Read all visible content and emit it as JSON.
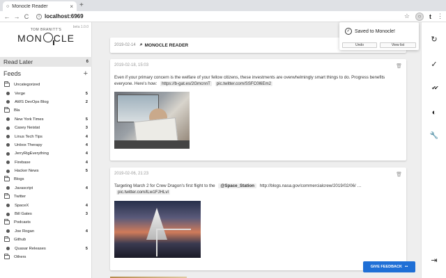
{
  "browser": {
    "tab_title": "Monocle Reader",
    "tab_close": "×",
    "new_tab": "+",
    "back": "←",
    "forward": "→",
    "reload": "C",
    "url": "localhost:6969",
    "star": "☆",
    "ext_t": "t",
    "menu": "⋮"
  },
  "sidebar": {
    "beta": "beta 1.0.0",
    "logo_small": "TOM BRANITT'S",
    "logo_left": "MON",
    "logo_right": "CLE",
    "read_later": {
      "label": "Read Later",
      "count": "6"
    },
    "feeds_label": "Feeds",
    "feeds_add": "+",
    "items": [
      {
        "kind": "folder",
        "label": "Uncategorized",
        "count": ""
      },
      {
        "kind": "feed",
        "label": "Verge",
        "count": "5"
      },
      {
        "kind": "feed",
        "label": "AWS DevOps Blog",
        "count": "2"
      },
      {
        "kind": "folder",
        "label": "Bla",
        "count": ""
      },
      {
        "kind": "feed",
        "label": "New York Times",
        "count": "5"
      },
      {
        "kind": "feed",
        "label": "Casey Neistat",
        "count": "3"
      },
      {
        "kind": "feed",
        "label": "Linus Tech Tips",
        "count": "4"
      },
      {
        "kind": "feed",
        "label": "Unbox Therapy",
        "count": "4"
      },
      {
        "kind": "feed",
        "label": "JerryRigEverything",
        "count": "4"
      },
      {
        "kind": "feed",
        "label": "Firebase",
        "count": "4"
      },
      {
        "kind": "feed",
        "label": "Hacker News",
        "count": "5"
      },
      {
        "kind": "folder",
        "label": "Blogs",
        "count": ""
      },
      {
        "kind": "feed",
        "label": "Javascript",
        "count": "4"
      },
      {
        "kind": "folder",
        "label": "Twitter",
        "count": ""
      },
      {
        "kind": "feed",
        "label": "SpaceX",
        "count": "4"
      },
      {
        "kind": "feed",
        "label": "Bill Gates",
        "count": "3"
      },
      {
        "kind": "folder",
        "label": "Podcasts",
        "count": ""
      },
      {
        "kind": "feed",
        "label": "Joe Rogan",
        "count": "4"
      },
      {
        "kind": "folder",
        "label": "Github",
        "count": ""
      },
      {
        "kind": "feed",
        "label": "Quasar Releases",
        "count": "5"
      },
      {
        "kind": "folder",
        "label": "Others",
        "count": ""
      }
    ]
  },
  "header_card": {
    "date": "2019-02-14",
    "title": "MONOCLE READER"
  },
  "posts": [
    {
      "date": "2019-02-18, 15:03",
      "text": "Even if your primary concern is the welfare of your fellow citizens, these investments are overwhelmingly smart things to do. Progress benefits everyone. Here's how:",
      "link1": "https://b-gat.es/2GmcnnT",
      "link2": "pic.twitter.com/SSFC0l6Em2"
    },
    {
      "date": "2019-02-06, 21:23",
      "text_before": "Targeting March 2 for Crew Dragon's first flight to the",
      "mention": "@Space_Station",
      "link1": "http://blogs.nasa.gov/commercialcrew/2019/02/06/ …",
      "link2": "pic.twitter.com/lLw1FJHLvl"
    }
  ],
  "toast": {
    "message": "Saved to Monocle!",
    "undo": "Undo",
    "view_list": "View list"
  },
  "rail": {
    "refresh": "↻",
    "check": "✓",
    "double_check": "✔✔",
    "theme": "◐",
    "settings": "🔧",
    "logout": "⇥"
  },
  "feedback": {
    "label": "GIVE FEEDBACK",
    "icon": "▪▪"
  }
}
